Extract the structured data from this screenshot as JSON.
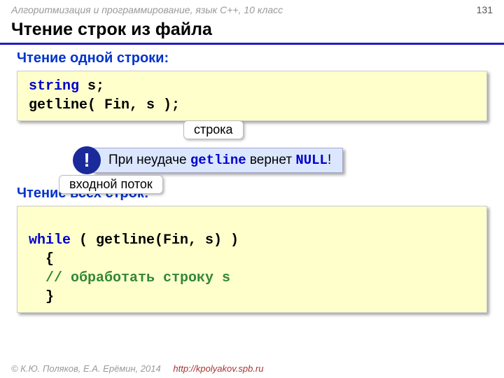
{
  "header": {
    "course": "Алгоритмизация и программирование, язык C++, 10 класс",
    "page": "131"
  },
  "title": "Чтение строк из файла",
  "section1": {
    "heading": "Чтение одной строки:",
    "code": {
      "t1": "string",
      "t2": " s;",
      "t3": "getline( Fin, s );"
    }
  },
  "labels": {
    "stroka": "строка",
    "potok": "входной поток"
  },
  "note": {
    "bang": "!",
    "p1": "При неудаче ",
    "p2": "getline",
    "p3": " вернет ",
    "p4": "NULL",
    "p5": "!"
  },
  "section2": {
    "heading": "Чтение всех строк:",
    "code": {
      "t1": "while",
      "t2": " ( getline(Fin, s) )",
      "t3": "  {",
      "t4": "  // обработать строку s",
      "t5": "  }"
    }
  },
  "footer": {
    "copyright": "© К.Ю. Поляков, Е.А. Ерёмин, 2014",
    "url": "http://kpolyakov.spb.ru"
  }
}
